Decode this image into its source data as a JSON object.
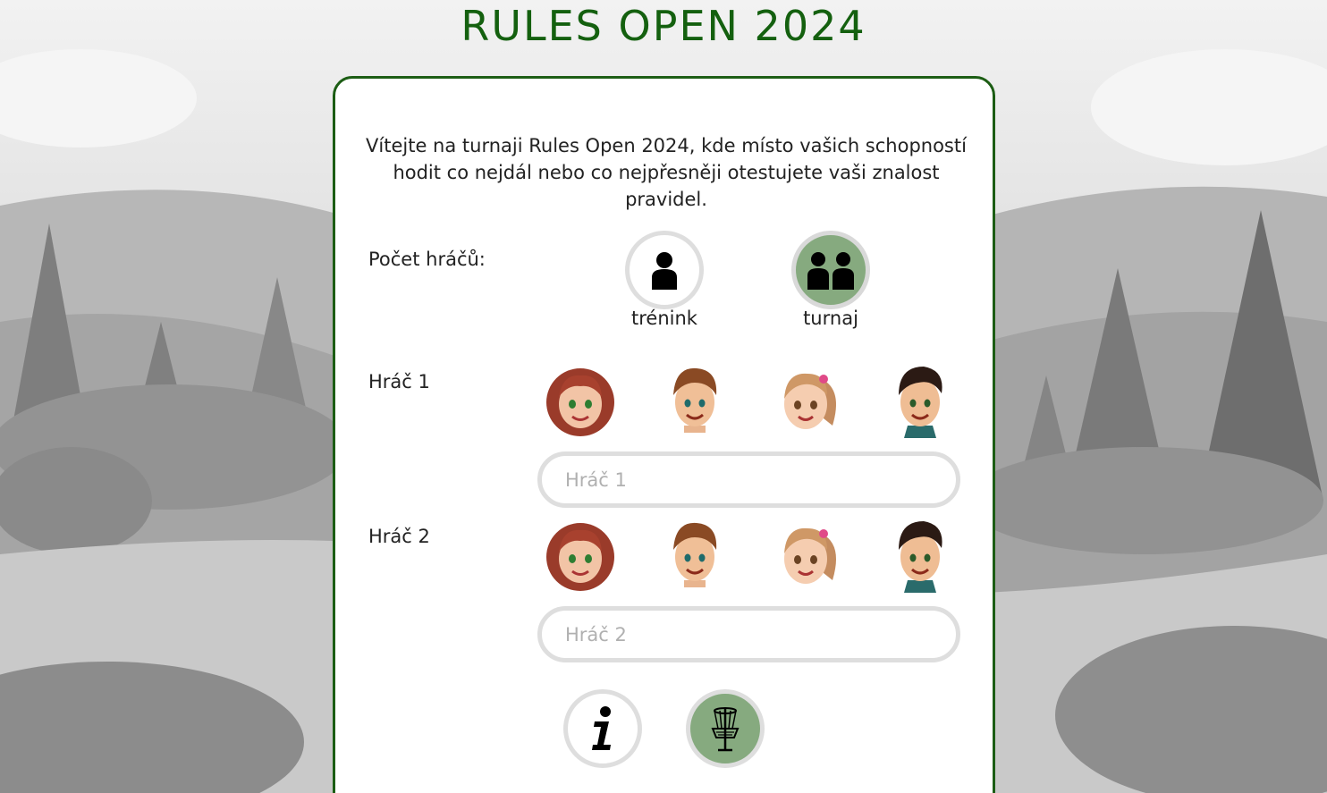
{
  "title": "RULES OPEN 2024",
  "intro": "Vítejte na turnaji Rules Open 2024, kde místo vašich schopností hodit co nejdál nebo co nejpřesněji otestujete vaši znalost pravidel.",
  "player_count": {
    "label": "Počet hráčů:",
    "options": [
      {
        "label": "trénink",
        "icon": "single-person-icon",
        "selected": false
      },
      {
        "label": "turnaj",
        "icon": "two-persons-icon",
        "selected": true
      }
    ]
  },
  "players": [
    {
      "label": "Hráč 1",
      "placeholder": "Hráč 1",
      "value": ""
    },
    {
      "label": "Hráč 2",
      "placeholder": "Hráč 2",
      "value": ""
    }
  ],
  "avatars": [
    "girl-curly-red-hair",
    "boy-brown-hair",
    "girl-ponytail",
    "boy-dark-hair"
  ],
  "actions": [
    {
      "icon": "info-icon"
    },
    {
      "icon": "disc-golf-basket-icon"
    }
  ],
  "colors": {
    "accent": "#14600f",
    "selected": "#86aa7f",
    "border": "#1c5d14"
  }
}
